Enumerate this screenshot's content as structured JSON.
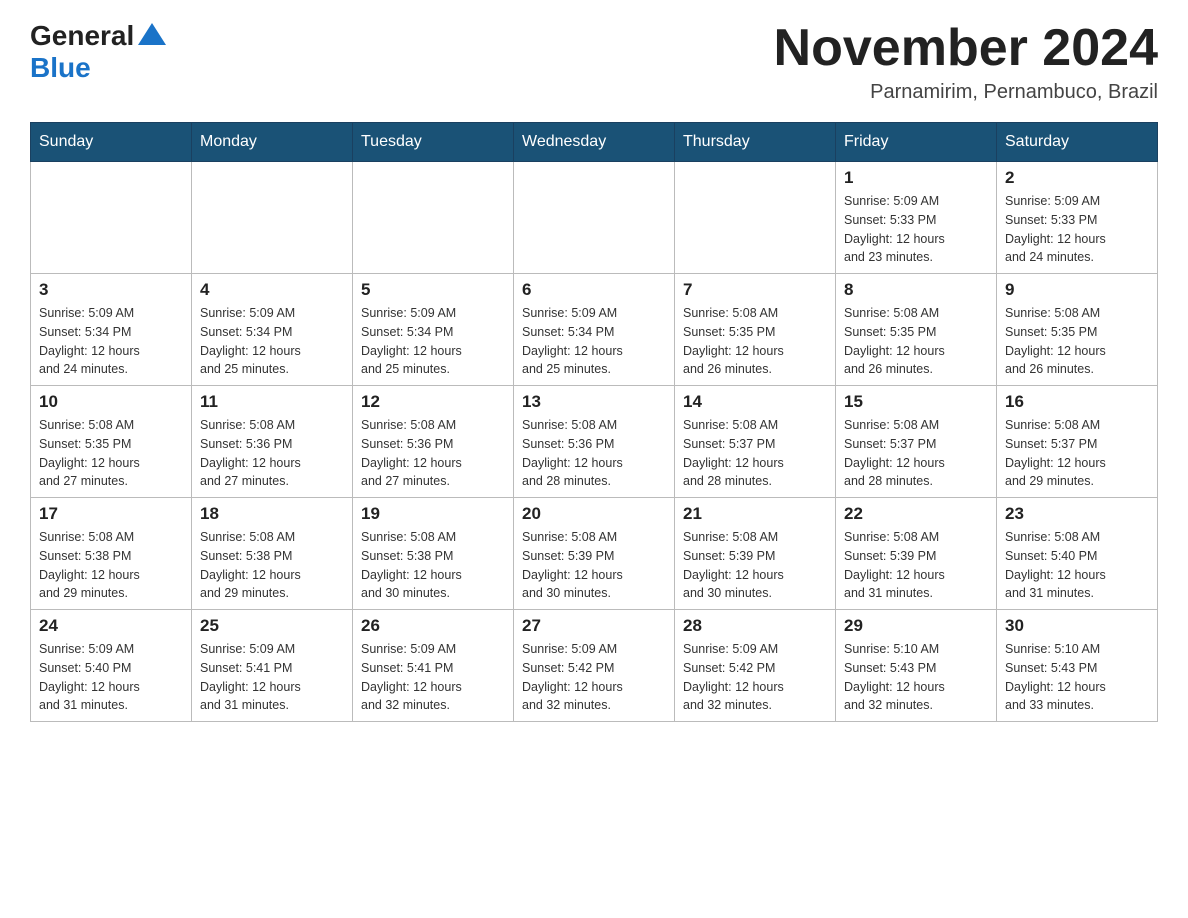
{
  "header": {
    "logo_general": "General",
    "logo_blue": "Blue",
    "month_title": "November 2024",
    "subtitle": "Parnamirim, Pernambuco, Brazil"
  },
  "days_of_week": [
    "Sunday",
    "Monday",
    "Tuesday",
    "Wednesday",
    "Thursday",
    "Friday",
    "Saturday"
  ],
  "weeks": [
    [
      {
        "day": "",
        "info": ""
      },
      {
        "day": "",
        "info": ""
      },
      {
        "day": "",
        "info": ""
      },
      {
        "day": "",
        "info": ""
      },
      {
        "day": "",
        "info": ""
      },
      {
        "day": "1",
        "info": "Sunrise: 5:09 AM\nSunset: 5:33 PM\nDaylight: 12 hours\nand 23 minutes."
      },
      {
        "day": "2",
        "info": "Sunrise: 5:09 AM\nSunset: 5:33 PM\nDaylight: 12 hours\nand 24 minutes."
      }
    ],
    [
      {
        "day": "3",
        "info": "Sunrise: 5:09 AM\nSunset: 5:34 PM\nDaylight: 12 hours\nand 24 minutes."
      },
      {
        "day": "4",
        "info": "Sunrise: 5:09 AM\nSunset: 5:34 PM\nDaylight: 12 hours\nand 25 minutes."
      },
      {
        "day": "5",
        "info": "Sunrise: 5:09 AM\nSunset: 5:34 PM\nDaylight: 12 hours\nand 25 minutes."
      },
      {
        "day": "6",
        "info": "Sunrise: 5:09 AM\nSunset: 5:34 PM\nDaylight: 12 hours\nand 25 minutes."
      },
      {
        "day": "7",
        "info": "Sunrise: 5:08 AM\nSunset: 5:35 PM\nDaylight: 12 hours\nand 26 minutes."
      },
      {
        "day": "8",
        "info": "Sunrise: 5:08 AM\nSunset: 5:35 PM\nDaylight: 12 hours\nand 26 minutes."
      },
      {
        "day": "9",
        "info": "Sunrise: 5:08 AM\nSunset: 5:35 PM\nDaylight: 12 hours\nand 26 minutes."
      }
    ],
    [
      {
        "day": "10",
        "info": "Sunrise: 5:08 AM\nSunset: 5:35 PM\nDaylight: 12 hours\nand 27 minutes."
      },
      {
        "day": "11",
        "info": "Sunrise: 5:08 AM\nSunset: 5:36 PM\nDaylight: 12 hours\nand 27 minutes."
      },
      {
        "day": "12",
        "info": "Sunrise: 5:08 AM\nSunset: 5:36 PM\nDaylight: 12 hours\nand 27 minutes."
      },
      {
        "day": "13",
        "info": "Sunrise: 5:08 AM\nSunset: 5:36 PM\nDaylight: 12 hours\nand 28 minutes."
      },
      {
        "day": "14",
        "info": "Sunrise: 5:08 AM\nSunset: 5:37 PM\nDaylight: 12 hours\nand 28 minutes."
      },
      {
        "day": "15",
        "info": "Sunrise: 5:08 AM\nSunset: 5:37 PM\nDaylight: 12 hours\nand 28 minutes."
      },
      {
        "day": "16",
        "info": "Sunrise: 5:08 AM\nSunset: 5:37 PM\nDaylight: 12 hours\nand 29 minutes."
      }
    ],
    [
      {
        "day": "17",
        "info": "Sunrise: 5:08 AM\nSunset: 5:38 PM\nDaylight: 12 hours\nand 29 minutes."
      },
      {
        "day": "18",
        "info": "Sunrise: 5:08 AM\nSunset: 5:38 PM\nDaylight: 12 hours\nand 29 minutes."
      },
      {
        "day": "19",
        "info": "Sunrise: 5:08 AM\nSunset: 5:38 PM\nDaylight: 12 hours\nand 30 minutes."
      },
      {
        "day": "20",
        "info": "Sunrise: 5:08 AM\nSunset: 5:39 PM\nDaylight: 12 hours\nand 30 minutes."
      },
      {
        "day": "21",
        "info": "Sunrise: 5:08 AM\nSunset: 5:39 PM\nDaylight: 12 hours\nand 30 minutes."
      },
      {
        "day": "22",
        "info": "Sunrise: 5:08 AM\nSunset: 5:39 PM\nDaylight: 12 hours\nand 31 minutes."
      },
      {
        "day": "23",
        "info": "Sunrise: 5:08 AM\nSunset: 5:40 PM\nDaylight: 12 hours\nand 31 minutes."
      }
    ],
    [
      {
        "day": "24",
        "info": "Sunrise: 5:09 AM\nSunset: 5:40 PM\nDaylight: 12 hours\nand 31 minutes."
      },
      {
        "day": "25",
        "info": "Sunrise: 5:09 AM\nSunset: 5:41 PM\nDaylight: 12 hours\nand 31 minutes."
      },
      {
        "day": "26",
        "info": "Sunrise: 5:09 AM\nSunset: 5:41 PM\nDaylight: 12 hours\nand 32 minutes."
      },
      {
        "day": "27",
        "info": "Sunrise: 5:09 AM\nSunset: 5:42 PM\nDaylight: 12 hours\nand 32 minutes."
      },
      {
        "day": "28",
        "info": "Sunrise: 5:09 AM\nSunset: 5:42 PM\nDaylight: 12 hours\nand 32 minutes."
      },
      {
        "day": "29",
        "info": "Sunrise: 5:10 AM\nSunset: 5:43 PM\nDaylight: 12 hours\nand 32 minutes."
      },
      {
        "day": "30",
        "info": "Sunrise: 5:10 AM\nSunset: 5:43 PM\nDaylight: 12 hours\nand 33 minutes."
      }
    ]
  ]
}
